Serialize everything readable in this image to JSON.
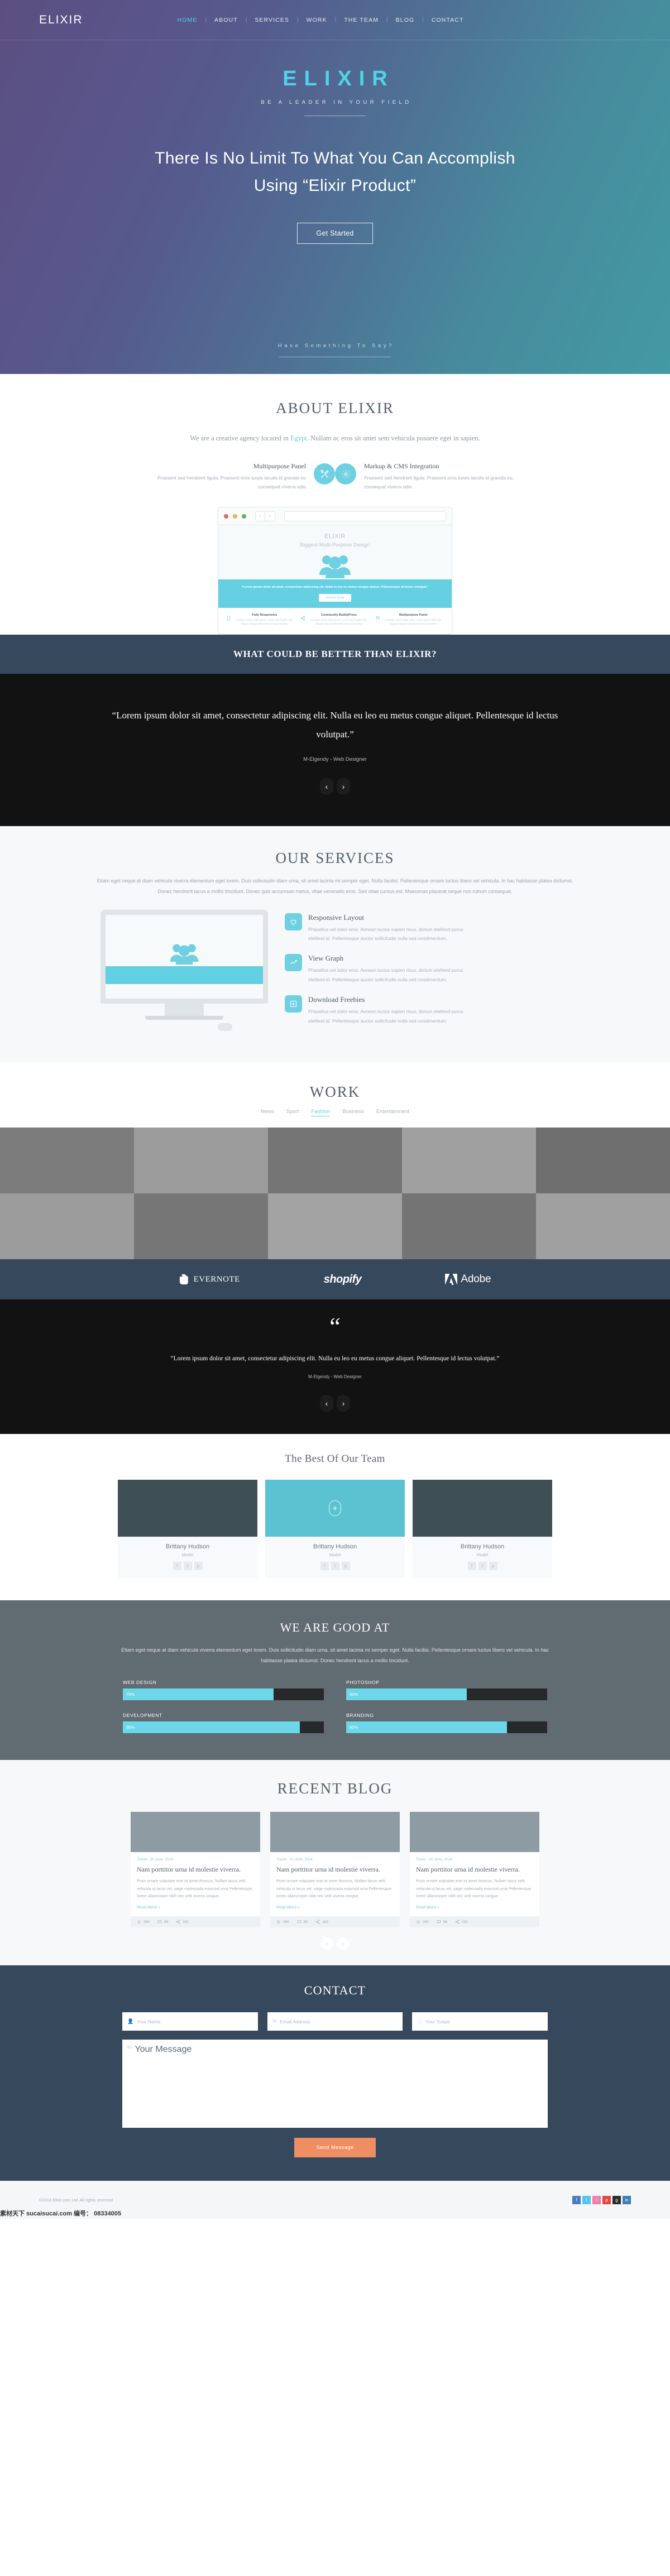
{
  "nav": {
    "brand": "ELIXIR",
    "items": [
      {
        "label": "HOME",
        "active": true
      },
      {
        "label": "ABOUT",
        "active": false
      },
      {
        "label": "SERVICES",
        "active": false
      },
      {
        "label": "WORK",
        "active": false
      },
      {
        "label": "THE TEAM",
        "active": false
      },
      {
        "label": "BLOG",
        "active": false
      },
      {
        "label": "CONTACT",
        "active": false
      }
    ],
    "separator": "|"
  },
  "hero": {
    "logo": "ELIXIR",
    "tagline": "BE A LEADER IN YOUR FIELD",
    "heading_line1": "There Is No Limit To What You Can Accomplish",
    "heading_line2": "Using “Elixir Product”",
    "cta": "Get Started",
    "bottom_text": "Have Something To Say?"
  },
  "about": {
    "title": "ABOUT  ELIXIR",
    "lead_before": "We are a creative agency located in ",
    "lead_link": "Egypt",
    "lead_after": ". Nullam ac eros sit amet sem vehicula posuere eget in sapien.",
    "features": [
      {
        "title": "Multipurpose Panel",
        "text": "Praesent sed hendrerit ligula. Praesent eros turpis iaculis id gravida eu .consequat viverra odio",
        "icon": "tools-icon"
      },
      {
        "title": "Markup & CMS Integration",
        "text": "Praesent sed hendrerit ligula. Praesent eros turpis iaculis id gravida eu, consequat viverra odio.",
        "icon": "gear-icon"
      }
    ],
    "mockup": {
      "title": "ELIXIR",
      "subtitle": "Biggest Multi-Purpose Design",
      "quote": "“Lorem ipsum dolor sit amet, consectetur adipiscing elit. Nulla eu leo eu metus congue aliquet. Pellentesque id lectus volutpat.”",
      "button": "Request Quote",
      "columns": [
        {
          "title": "Fully Responsive",
          "text": "Curabitur varius mattis ipsum. Lorem quis fringilla nibh. Aliquam aliquam bibendum sed quis faucibus."
        },
        {
          "title": "Community BuddyPress",
          "text": "Curabitur varius mattis ipsum. Lorem quis fringilla nibh. Aliquam aliquam bibendum sed quis faucibus."
        },
        {
          "title": "Multipurpose Panel",
          "text": "Curabitur varius mattis ipsum. Lorem quis fringilla nibh. Aliquam aliquam bibendum sed quis faucibus."
        }
      ]
    }
  },
  "banner": {
    "text": "WHAT COULD BE BETTER THAN ELIXIR?"
  },
  "testimonial1": {
    "quote": "“Lorem ipsum dolor sit amet, consectetur adipiscing elit. Nulla eu leo eu metus congue aliquet. Pellentesque id lectus volutpat.”",
    "author": "M-Elgendy - Web Designer",
    "prev": "‹",
    "next": "›"
  },
  "services": {
    "title": "OUR SERVICES",
    "intro": "Etiam eget neque at diam vehicula viverra elementum eget lorem. Duis sollicitudin diam urna, sit amet lacinia mi semper eget. Nulla facilisi. Pellentesque ornare luctus libero vel vehicula. In hac habitasse platea dictumst. Donec hendrerit lacus a mollis tincidunt. Donec quis accumsan metus, vitae venenatis eros. Sed vitae cursus est. Maecenas placerat neque non rutrum consequat.",
    "items": [
      {
        "title": "Responsive Layout",
        "text": "Phasellus vel dolor eros. Aenean luctus sapien risus, dictum eleifend purus eleifend id. Pellentesque auctor sollicitudin nulla sed condimentum.",
        "icon": "heart-icon"
      },
      {
        "title": "View Graph",
        "text": "Phasellus vel dolor eros. Aenean luctus sapien risus, dictum eleifend purus eleifend id. Pellentesque auctor sollicitudin nulla sed condimentum.",
        "icon": "graph-icon"
      },
      {
        "title": "Download Freebies",
        "text": "Phasellus vel dolor eros. Aenean luctus sapien risus, dictum eleifend purus eleifend id. Pellentesque auctor sollicitudin nulla sed condimentum.",
        "icon": "download-icon"
      }
    ]
  },
  "work": {
    "title": "WORK",
    "filters": [
      {
        "label": "News",
        "active": false
      },
      {
        "label": "Sport",
        "active": false
      },
      {
        "label": "Fashion",
        "active": true
      },
      {
        "label": "Business",
        "active": false
      },
      {
        "label": "Entertainment",
        "active": false
      }
    ],
    "tiles": [
      "#7b7b7b",
      "#9c9c9c",
      "#757575",
      "#a0a0a0",
      "#6f6f6f",
      "#9c9c9c",
      "#767676",
      "#a3a3a3",
      "#747474",
      "#a0a0a0"
    ]
  },
  "clients": [
    {
      "name": "EVERNOTE",
      "id": "evernote-logo"
    },
    {
      "name": "shopify",
      "id": "shopify-logo"
    },
    {
      "name": "Adobe",
      "id": "adobe-logo"
    }
  ],
  "testimonial2": {
    "mark": "“",
    "quote": "“Lorem ipsum dolor sit amet, consectetur adipiscing elit. Nulla eu leo eu metus congue aliquet. Pellentesque id lectus volutpat.”",
    "author": "M-Elgendy - Web Designer",
    "prev": "‹",
    "next": "›"
  },
  "team": {
    "title": "The Best Of Our Team",
    "members": [
      {
        "name": "Brittany Hudson",
        "role": "Model",
        "featured": false
      },
      {
        "name": "Brittany Hudson",
        "role": "Model",
        "featured": true
      },
      {
        "name": "Brittany Hudson",
        "role": "Model",
        "featured": false
      }
    ],
    "social": [
      "f",
      "t",
      "p"
    ],
    "plus": "+"
  },
  "skills": {
    "title": "WE ARE GOOD AT",
    "intro": "Etiam eget neque at diam vehicula viverra elementum eget lorem. Duis sollicitudin diam urna, sit amet lacinia mi semper eget. Nulla facilisi. Pellentesque ornare luctus libero vel vehicula. In hac habitasse platea dictumst. Donec hendrerit lacus a mollis tincidunt.",
    "bars": [
      {
        "label": "WEB DESIGN",
        "value": 75,
        "display": "75%"
      },
      {
        "label": "PHOTOSHOP",
        "value": 60,
        "display": "60%"
      },
      {
        "label": "DEVELOPMENT",
        "value": 95,
        "display": "95%"
      },
      {
        "label": "BRANDING",
        "value": 80,
        "display": "80%"
      }
    ]
  },
  "blog": {
    "title": "RECENT BLOG",
    "posts": [
      {
        "meta_category": "Travel",
        "meta_date": " - 30 June, 2014",
        "title": "Nam porttitor urna id molestie viverra.",
        "excerpt": "Proin ornare vulputate erat sit amet rhoncus. Nullam lacus velit, vehicula ut lacus vel, saige malesuada euismod urna Pellentesque  lorem ullamcorper nibh nec velit viverra congue.",
        "more": "Read about »",
        "likes": "260",
        "comments": "98",
        "shares": "162"
      },
      {
        "meta_category": "Travel",
        "meta_date": " - 30 June, 2014",
        "title": "Nam porttitor urna id molestie viverra.",
        "excerpt": "Proin ornare vulputate erat sit amet rhoncus. Nullam lacus velit, vehicula ut lacus vel, saige malesuada euismod urna Pellentesque  lorem ullamcorper nibh nec velit viverra congue.",
        "more": "Read about »",
        "likes": "260",
        "comments": "98",
        "shares": "162"
      },
      {
        "meta_category": "Travel",
        "meta_date": " - 30 June, 2014",
        "title": "Nam porttitor urna id molestie viverra.",
        "excerpt": "Proin ornare vulputate erat sit amet rhoncus. Nullam lacus velit, vehicula ut lacus vel, saige malesuada euismod urna Pellentesque  lorem ullamcorper nibh nec velit viverra congue.",
        "more": "Read about »",
        "likes": "260",
        "comments": "98",
        "shares": "162"
      }
    ],
    "prev": "‹",
    "next": "›"
  },
  "contact": {
    "title": "CONTACT",
    "name_placeholder": "Your Name",
    "email_placeholder": "Email Address",
    "subject_placeholder": "Your Subjet",
    "message_placeholder": "Your Message",
    "submit": "Send Message"
  },
  "footer": {
    "copyright": "©2014 Elixir.com Ltd. All rights reserved",
    "social": [
      {
        "glyph": "f",
        "color": "#4a7bc2"
      },
      {
        "glyph": "t",
        "color": "#52c5ef"
      },
      {
        "glyph": "ⓘ",
        "color": "#f07aa8"
      },
      {
        "glyph": "p",
        "color": "#e0473e"
      },
      {
        "glyph": "g",
        "color": "#2b2b2b"
      },
      {
        "glyph": "in",
        "color": "#3b7fb5"
      }
    ],
    "watermark": "素材天下 sucaisucai.com  编号： 08334005"
  },
  "colors": {
    "accent": "#6fd0e2",
    "dark": "#36485c",
    "black": "#121212",
    "orange": "#ef8d63"
  }
}
